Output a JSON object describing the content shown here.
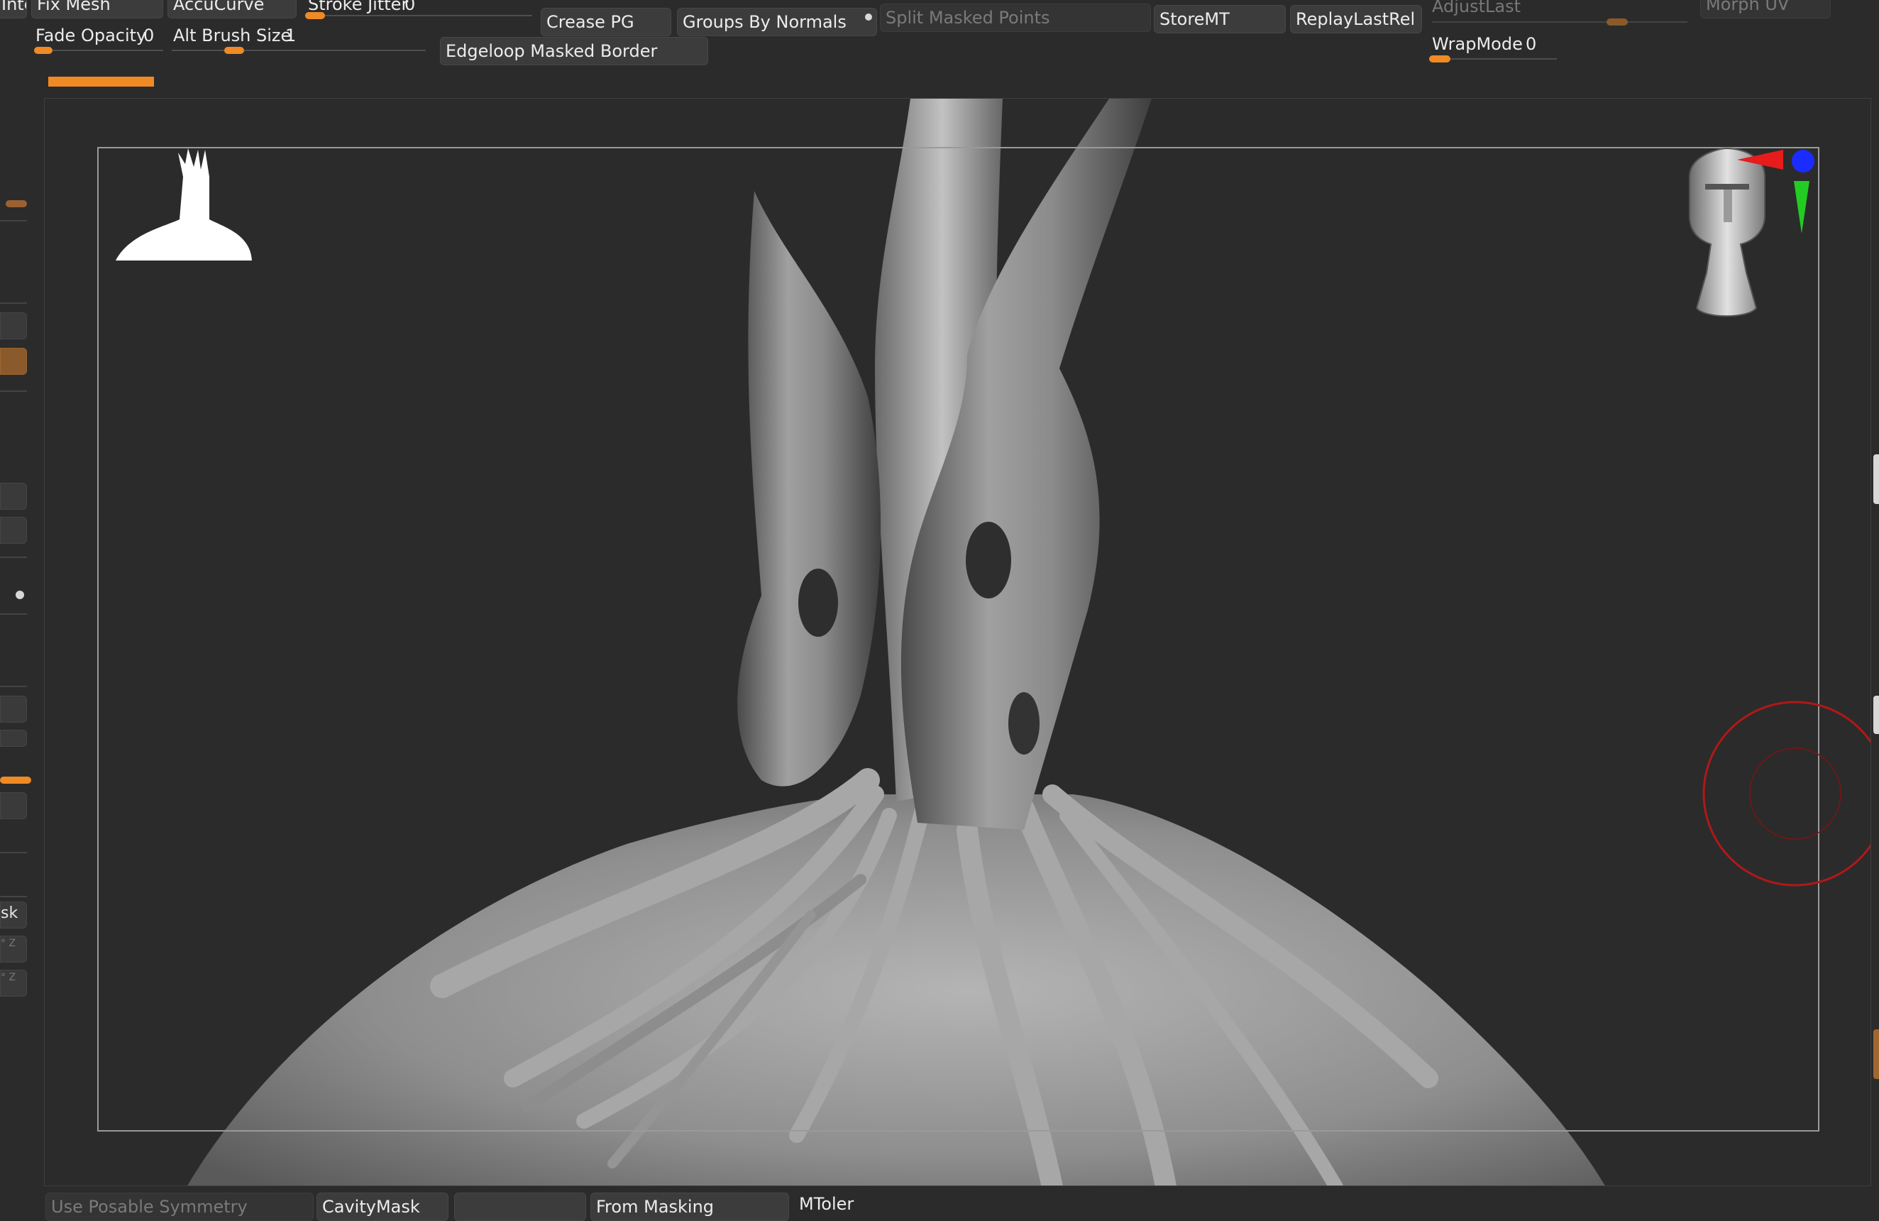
{
  "toolbar": {
    "row1": {
      "inte": "Inte",
      "fix_mesh": "Fix Mesh",
      "accucurve": "AccuCurve",
      "stroke_jitter": {
        "label": "Stroke Jitter",
        "value": "0"
      },
      "crease_pg": "Crease PG",
      "groups_by_normals": "Groups By Normals",
      "split_masked_points": "Split Masked Points",
      "store_mt": "StoreMT",
      "replay_last_rel": "ReplayLastRel",
      "adjust_last": "AdjustLast",
      "morph_uv": "Morph UV"
    },
    "row2": {
      "fade_opacity": {
        "label": "Fade Opacity",
        "value": "0"
      },
      "alt_brush_size": {
        "label": "Alt Brush Size",
        "value": "1"
      },
      "edgeloop_masked_border": "Edgeloop Masked Border",
      "wrap_mode": {
        "label": "WrapMode",
        "value": "0"
      }
    }
  },
  "left_panel": {
    "mask_label": "sk",
    "xyz_1": "° Z",
    "xyz_2": "° Z"
  },
  "bottom_bar": {
    "use_posable_symmetry": "Use Posable Symmetry",
    "cavity_mask": "CavityMask",
    "blank": "",
    "from_masking": "From Masking",
    "mtolerance": "MToler"
  },
  "viewport": {
    "progress_fraction": 0.18
  },
  "colors": {
    "accent": "#f08a24",
    "axis_x": "#e81c1c",
    "axis_y": "#22cc22",
    "axis_z": "#1a2cff",
    "brush_ring": "#b01818"
  }
}
